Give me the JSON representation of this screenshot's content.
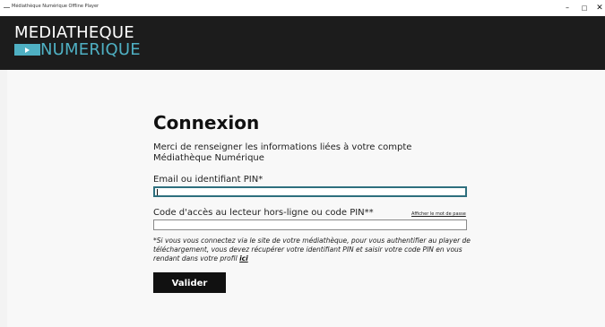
{
  "window": {
    "title": "Médiathèque Numérique Offline Player",
    "minimize": "–",
    "maximize": "□",
    "close": "✕"
  },
  "logo": {
    "line1": "MEDIATHEQUE",
    "line2": "NUMERIQUE",
    "accent_color": "#4fb0c3"
  },
  "login": {
    "heading": "Connexion",
    "intro": "Merci de renseigner les informations liées à votre compte Médiathèque Numérique",
    "email_label": "Email ou identifiant PIN*",
    "email_value": "",
    "code_label": "Code d'accès au lecteur hors-ligne ou code PIN**",
    "show_password": "Afficher le mot de passe",
    "code_value": "",
    "note_text": "*Si vous vous connectez via le site de votre médiathèque, pour vous authentifier au player de téléchargement, vous devez récupérer votre identifiant PIN et saisir votre code PIN en vous rendant dans votre profil ",
    "note_link": "ici",
    "submit": "Valider"
  },
  "colors": {
    "header_bg": "#1c1c1c",
    "focus_border": "#2e6f7e",
    "button_bg": "#111111"
  }
}
